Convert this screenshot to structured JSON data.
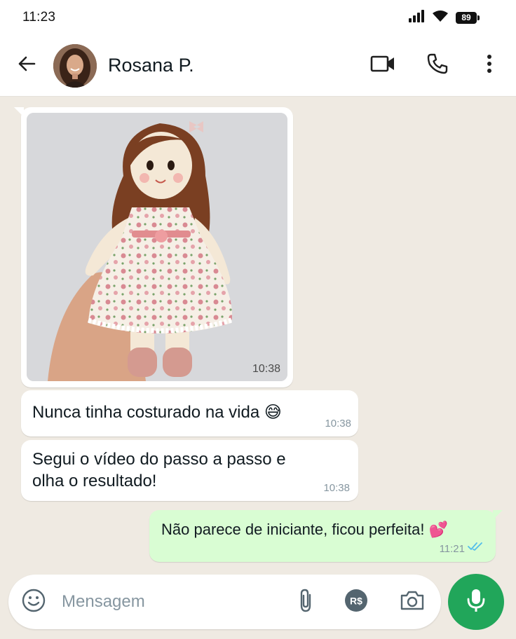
{
  "status_bar": {
    "time": "11:23",
    "battery": "89"
  },
  "header": {
    "contact_name": "Rosana P.",
    "icons": [
      "back-arrow-icon",
      "video-call-icon",
      "phone-icon",
      "more-vertical-icon"
    ]
  },
  "messages": [
    {
      "type": "image",
      "direction": "in",
      "time": "10:38",
      "image": "rag-doll-photo"
    },
    {
      "type": "text",
      "direction": "in",
      "text": "Nunca tinha costurado na vida 😅",
      "time": "10:38"
    },
    {
      "type": "text",
      "direction": "in",
      "text": "Segui o vídeo do passo a passo e olha o resultado!",
      "time": "10:38"
    },
    {
      "type": "text",
      "direction": "out",
      "text": "Não parece de iniciante, ficou perfeita! 💕",
      "time": "11:21",
      "status": "read"
    }
  ],
  "composer": {
    "placeholder": "Mensagem",
    "value": "",
    "icons": [
      "emoji-icon",
      "paperclip-icon",
      "pix-payment-icon",
      "camera-icon",
      "microphone-icon"
    ],
    "pay_label": "R$"
  },
  "colors": {
    "chat_background": "#efeae2",
    "outgoing_bubble": "#d9fdd3",
    "incoming_bubble": "#ffffff",
    "accent_green": "#21a65a",
    "read_ticks": "#53bdeb"
  }
}
